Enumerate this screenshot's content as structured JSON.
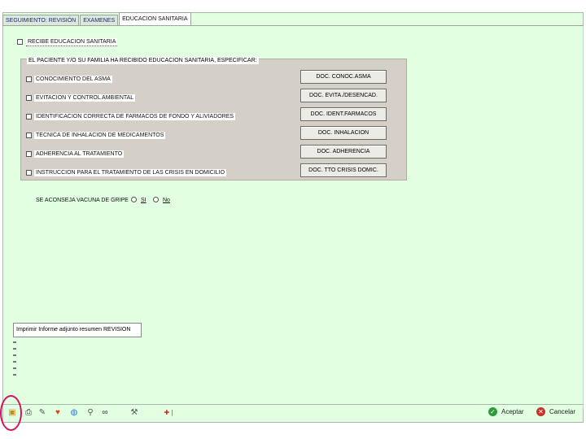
{
  "tabs": [
    {
      "label": "SEGUIMIENTO: REVISIÓN",
      "active": false
    },
    {
      "label": "EXAMENES",
      "active": false
    },
    {
      "label": "EDUCACION SANITARIA",
      "active": true
    }
  ],
  "recibe": {
    "label": "RECIBE EDUCACION SANITARIA",
    "checked": false
  },
  "group_title": "EL PACIENTE Y/O SU FAMILIA HA RECIBIDO EDUCACION SANITARIA, ESPECIFICAR:",
  "items": [
    {
      "label": "CONOCIMIENTO DEL ASMA",
      "button": "DOC. CONOC.ASMA",
      "checked": false
    },
    {
      "label": "EVITACION Y CONTROL AMBIENTAL",
      "button": "DOC. EVITA./DESENCAD.",
      "checked": false
    },
    {
      "label": "IDENTIFICACION CORRECTA DE FARMACOS DE FONDO Y ALIVIADORES",
      "button": "DOC. IDENT.FARMACOS",
      "checked": false
    },
    {
      "label": "TECNICA DE INHALACION DE MEDICAMENTOS",
      "button": "DOC. INHALACION",
      "checked": false
    },
    {
      "label": "ADHERENCIA AL TRATAMIENTO",
      "button": "DOC. ADHERENCIA",
      "checked": false
    },
    {
      "label": "INSTRUCCION PARA EL TRATAMIENTO DE LAS CRISIS EN DOMICILIO",
      "button": "DOC. TTO CRISIS DOMIC.",
      "checked": false
    }
  ],
  "vacuna": {
    "question": "SE ACONSEJA VACUNA DE GRIPE",
    "options": [
      "SI",
      "No"
    ],
    "selected": null
  },
  "inform_button": "Imprimir Informe adjunto resumen REVISION",
  "toolbar_icons": [
    "folder-icon",
    "printer-icon",
    "pen-icon",
    "heart-icon",
    "globe-icon",
    "magnifier-icon",
    "glasses-icon",
    "tool-icon",
    "flag-icon"
  ],
  "actions": {
    "accept": {
      "label": "Aceptar",
      "color": "#2e9b3a"
    },
    "cancel": {
      "label": "Cancelar",
      "color": "#c8322d"
    }
  },
  "colors": {
    "background": "#e2ffe2",
    "group": "#d4d0c8",
    "highlight_circle": "#d4145a"
  }
}
